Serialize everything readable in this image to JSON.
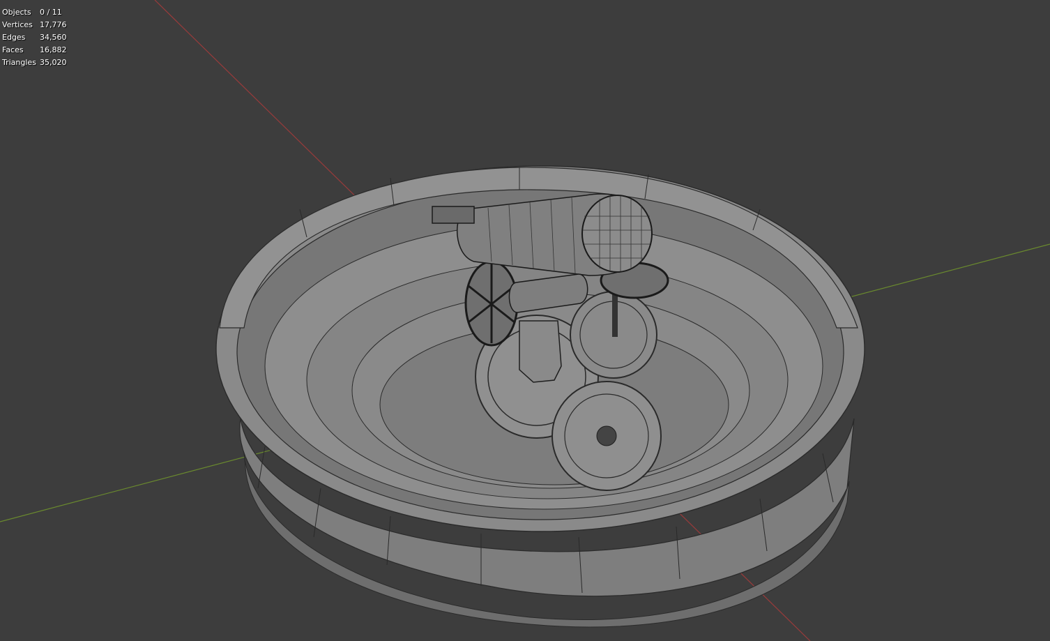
{
  "stats": {
    "objects_label": "Objects",
    "objects_value": "0 / 11",
    "vertices_label": "Vertices",
    "vertices_value": "17,776",
    "edges_label": "Edges",
    "edges_value": "34,560",
    "faces_label": "Faces",
    "faces_value": "16,882",
    "triangles_label": "Triangles",
    "triangles_value": "35,020"
  },
  "colors": {
    "background": "#3d3d3d",
    "x_axis": "#9a3b3b",
    "y_axis": "#6a8a2e",
    "mesh_face": "#8d8d8d",
    "wire": "#2a2a2a"
  }
}
